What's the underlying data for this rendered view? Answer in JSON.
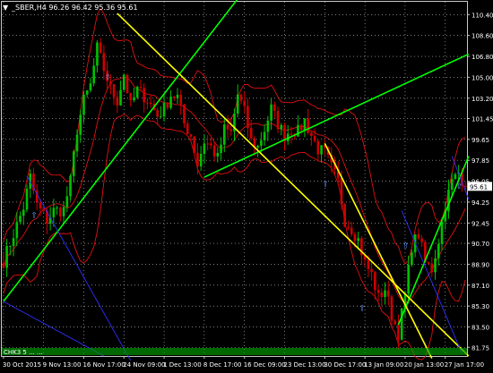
{
  "window": {
    "title": "_SBER,H4  96.26 96.42 95.36 95.61"
  },
  "indicator_label": "CHK3 5 ... ...",
  "chart_data": {
    "type": "candlestick",
    "symbol": "_SBER",
    "timeframe": "H4",
    "ohlc_header": {
      "open": 96.26,
      "high": 96.42,
      "low": 95.36,
      "close": 95.61
    },
    "current_price": 95.61,
    "ylim": [
      81.0,
      111.5
    ],
    "y_ticks": [
      110.4,
      108.6,
      106.8,
      105.0,
      103.2,
      101.45,
      99.65,
      97.85,
      96.05,
      94.25,
      92.45,
      90.7,
      88.9,
      87.1,
      85.3,
      83.5,
      81.75
    ],
    "x_labels": [
      "30 Oct 2015",
      "9 Nov 13:00",
      "16 Nov 17:00",
      "24 Nov 09:00",
      "1 Dec 13:00",
      "8 Dec 17:00",
      "16 Dec 09:00",
      "23 Dec 13:00",
      "30 Dec 17:00",
      "13 Jan 09:00",
      "20 Jan 13:00",
      "27 Jan 17:00"
    ],
    "x_label_bars": [
      0,
      12,
      24,
      36,
      48,
      60,
      72,
      84,
      96,
      108,
      120,
      132
    ],
    "bar_count": 139,
    "close_path": [
      [
        0,
        89.2
      ],
      [
        3,
        91.5
      ],
      [
        6,
        93.8
      ],
      [
        8,
        96.4
      ],
      [
        10,
        94.0
      ],
      [
        13,
        92.7
      ],
      [
        15,
        93.5
      ],
      [
        18,
        93.6
      ],
      [
        20,
        96.0
      ],
      [
        22,
        100.5
      ],
      [
        24,
        103.0
      ],
      [
        26,
        104.3
      ],
      [
        28,
        107.5
      ],
      [
        30,
        105.7
      ],
      [
        32,
        104.0
      ],
      [
        34,
        103.0
      ],
      [
        36,
        105.3
      ],
      [
        38,
        102.5
      ],
      [
        40,
        103.9
      ],
      [
        43,
        103.1
      ],
      [
        46,
        101.7
      ],
      [
        48,
        102.3
      ],
      [
        50,
        103.5
      ],
      [
        52,
        103.3
      ],
      [
        54,
        101.0
      ],
      [
        56,
        100.0
      ],
      [
        58,
        97.5
      ],
      [
        60,
        99.5
      ],
      [
        62,
        99.0
      ],
      [
        64,
        98.0
      ],
      [
        66,
        100.5
      ],
      [
        68,
        100.2
      ],
      [
        70,
        103.5
      ],
      [
        72,
        102.0
      ],
      [
        74,
        99.5
      ],
      [
        76,
        99.0
      ],
      [
        78,
        100.5
      ],
      [
        80,
        102.3
      ],
      [
        82,
        101.0
      ],
      [
        84,
        100.0
      ],
      [
        86,
        100.5
      ],
      [
        88,
        100.3
      ],
      [
        90,
        101.3
      ],
      [
        92,
        100.0
      ],
      [
        94,
        98.8
      ],
      [
        96,
        98.5
      ],
      [
        98,
        97.2
      ],
      [
        100,
        96.0
      ],
      [
        102,
        92.7
      ],
      [
        104,
        92.0
      ],
      [
        106,
        91.0
      ],
      [
        108,
        89.0
      ],
      [
        110,
        88.0
      ],
      [
        112,
        86.0
      ],
      [
        114,
        86.8
      ],
      [
        116,
        84.5
      ],
      [
        118,
        83.0
      ],
      [
        120,
        86.2
      ],
      [
        122,
        90.5
      ],
      [
        124,
        91.5
      ],
      [
        126,
        89.0
      ],
      [
        128,
        88.5
      ],
      [
        130,
        91.0
      ],
      [
        132,
        94.0
      ],
      [
        134,
        96.0
      ],
      [
        136,
        96.8
      ],
      [
        138,
        95.61
      ]
    ],
    "bollinger_offset_approx": 5.0,
    "trendlines": [
      {
        "color": "#00ff00",
        "points": [
          [
            0,
            85.7
          ],
          [
            72,
            112.5
          ]
        ]
      },
      {
        "color": "#00ff00",
        "points": [
          [
            60,
            96.4
          ],
          [
            139,
            107.0
          ]
        ]
      },
      {
        "color": "#00ff00",
        "points": [
          [
            118,
            83.7
          ],
          [
            139,
            98.2
          ]
        ]
      },
      {
        "color": "#ffff00",
        "points": [
          [
            34,
            110.5
          ],
          [
            139,
            81.0
          ]
        ]
      },
      {
        "color": "#ffff00",
        "points": [
          [
            96,
            99.3
          ],
          [
            128,
            80.8
          ]
        ]
      },
      {
        "color": "#3030ff",
        "points": [
          [
            7,
            96.5
          ],
          [
            38,
            80.6
          ]
        ]
      },
      {
        "color": "#3030ff",
        "points": [
          [
            0,
            85.7
          ],
          [
            30,
            81.0
          ]
        ]
      },
      {
        "color": "#3030ff",
        "points": [
          [
            119,
            93.5
          ],
          [
            137,
            81.2
          ]
        ]
      },
      {
        "color": "#3030ff",
        "points": [
          [
            134,
            98.2
          ],
          [
            139,
            94.5
          ]
        ]
      }
    ],
    "arrow_markers": [
      {
        "bar": 9,
        "price": 93.2
      },
      {
        "bar": 31,
        "price": 105.1
      },
      {
        "bar": 96,
        "price": 95.9
      },
      {
        "bar": 107,
        "price": 85.2
      },
      {
        "bar": 120,
        "price": 90.6
      },
      {
        "bar": 136,
        "price": 95.7
      }
    ],
    "colors": {
      "background": "#000000",
      "grid": "#c8c8c8",
      "bull_candle": "#00c000",
      "bear_candle": "#d00000",
      "bollinger": "#e01010",
      "axis_text": "#ffffff",
      "price_marker_bg": "#ffffff",
      "price_marker_text": "#000000"
    }
  }
}
